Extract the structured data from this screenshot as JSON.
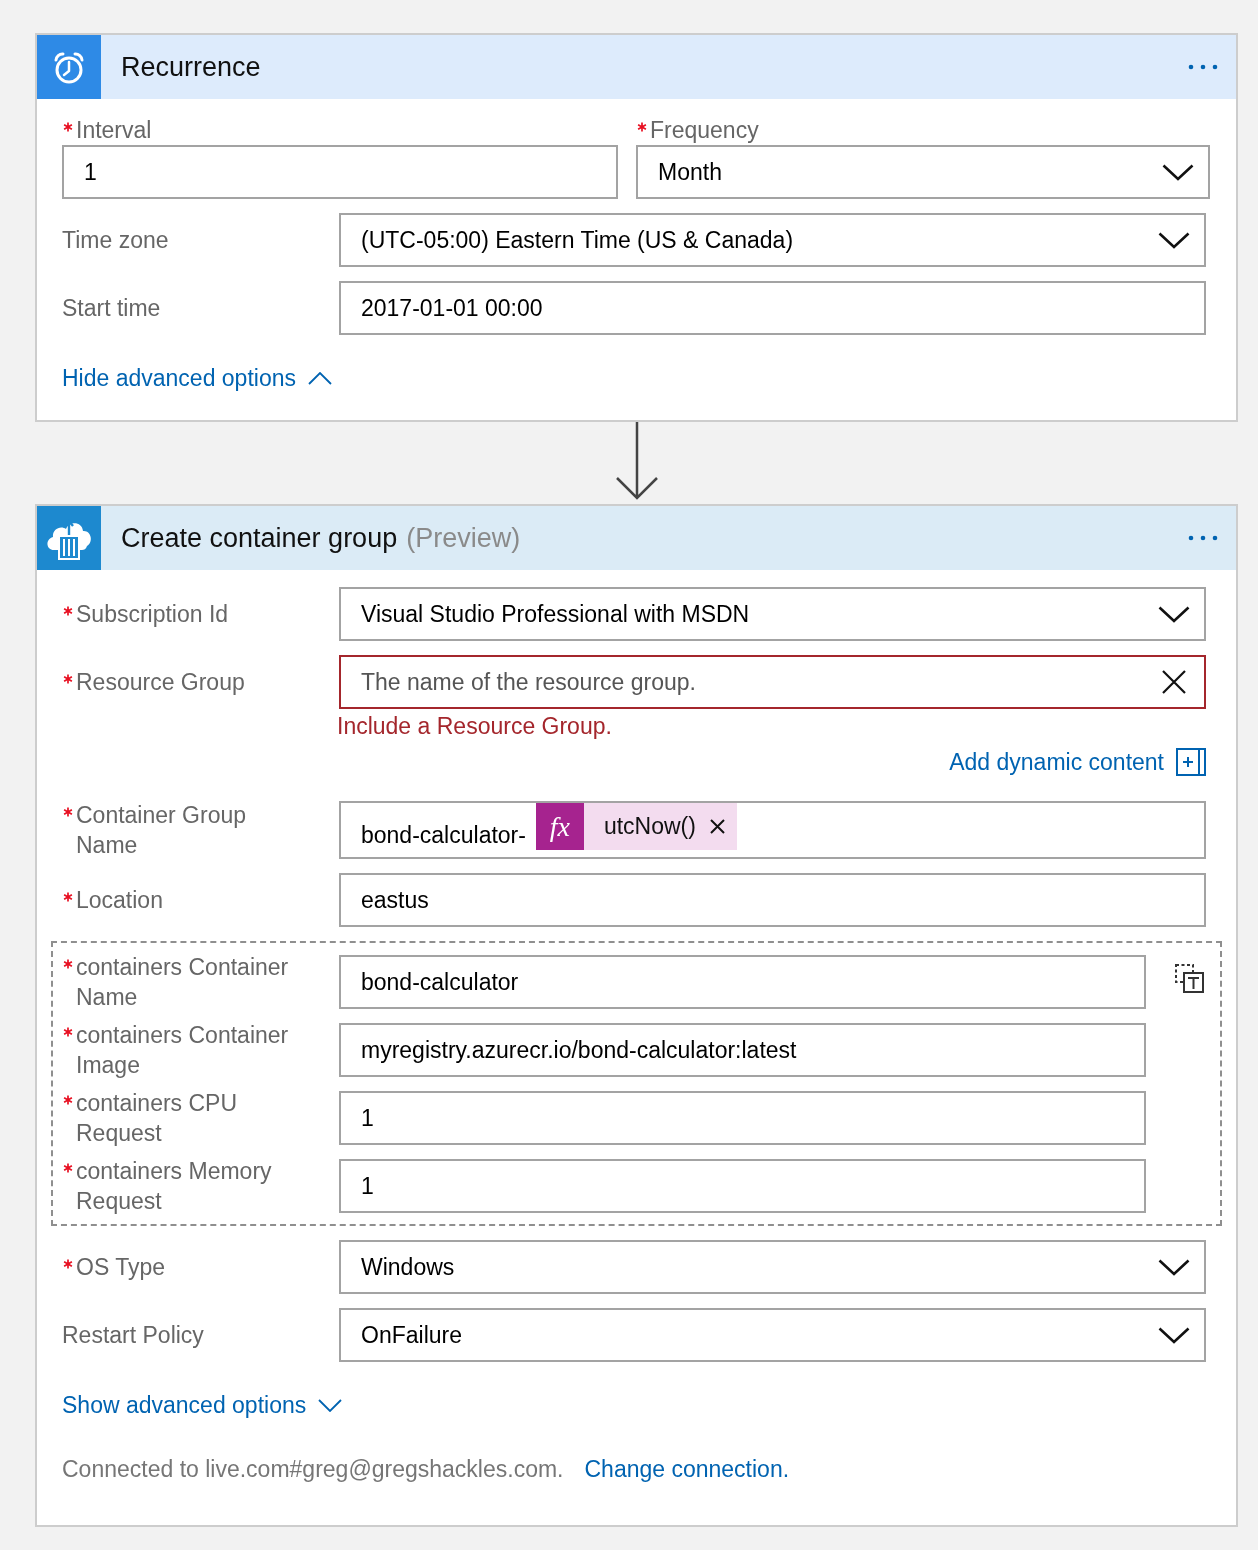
{
  "cards": [
    {
      "kind": "trigger",
      "title": "Recurrence",
      "top_row": [
        {
          "label": "Interval",
          "required": true,
          "kind": "text",
          "value": "1"
        },
        {
          "label": "Frequency",
          "required": true,
          "kind": "select",
          "value": "Month"
        }
      ],
      "fields": [
        {
          "label": "Time zone",
          "required": false,
          "kind": "select",
          "value": "(UTC-05:00) Eastern Time (US & Canada)"
        },
        {
          "label": "Start time",
          "required": false,
          "kind": "text",
          "value": "2017-01-01 00:00"
        }
      ],
      "advanced_toggle": {
        "label": "Hide advanced options",
        "expanded": true
      }
    },
    {
      "kind": "action",
      "title": "Create container group",
      "tag": "(Preview)",
      "fields": [
        {
          "label": "Subscription Id",
          "required": true,
          "kind": "select",
          "value": "Visual Studio Professional with MSDN"
        },
        {
          "label": "Resource Group",
          "required": true,
          "kind": "text",
          "placeholder": "The name of the resource group.",
          "invalid": true,
          "error": "Include a Resource Group.",
          "link": "Add dynamic content"
        },
        {
          "label": "Container Group Name",
          "required": true,
          "kind": "token",
          "value": "bond-calculator-",
          "token": {
            "badge": "fx",
            "label": "utcNow()"
          }
        },
        {
          "label": "Location",
          "required": true,
          "kind": "text",
          "value": "eastus"
        },
        {
          "kind": "group",
          "fields": [
            {
              "label": "containers Container Name",
              "required": true,
              "kind": "text",
              "value": "bond-calculator"
            },
            {
              "label": "containers Container Image",
              "required": true,
              "kind": "text",
              "value": "myregistry.azurecr.io/bond-calculator:latest"
            },
            {
              "label": "containers CPU Request",
              "required": true,
              "kind": "text",
              "value": "1"
            },
            {
              "label": "containers Memory Request",
              "required": true,
              "kind": "text",
              "value": "1"
            }
          ]
        },
        {
          "label": "OS Type",
          "required": true,
          "kind": "select",
          "value": "Windows"
        },
        {
          "label": "Restart Policy",
          "required": false,
          "kind": "select",
          "value": "OnFailure"
        }
      ],
      "advanced_toggle": {
        "label": "Show advanced options",
        "expanded": false
      },
      "connection": {
        "status": "Connected to live.com#greg@gregshackles.com.",
        "link": "Change connection."
      }
    }
  ]
}
